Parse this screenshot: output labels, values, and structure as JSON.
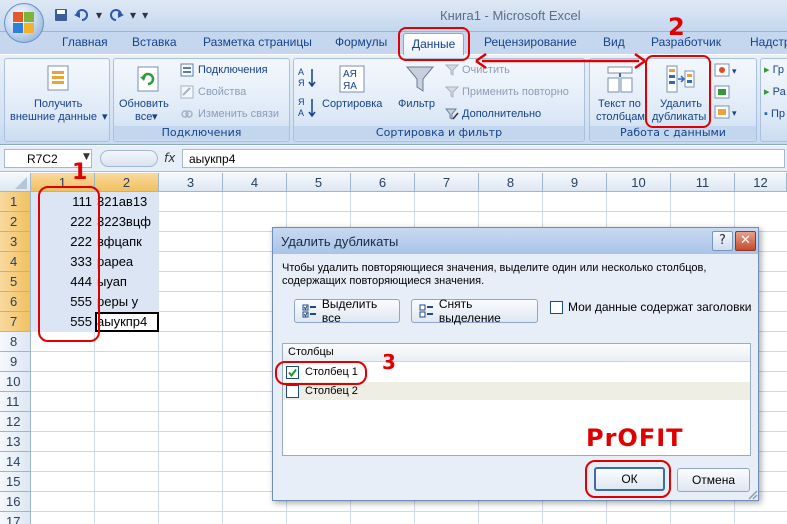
{
  "window": {
    "title": "Книга1 - Microsoft Excel"
  },
  "quick_access": {
    "save_icon": "save-icon",
    "undo_icon": "undo-icon",
    "redo_icon": "redo-icon",
    "customize_glyph": "▾"
  },
  "tabs": [
    {
      "label": "Главная"
    },
    {
      "label": "Вставка"
    },
    {
      "label": "Разметка страницы"
    },
    {
      "label": "Формулы"
    },
    {
      "label": "Данные",
      "active": true
    },
    {
      "label": "Рецензирование"
    },
    {
      "label": "Вид"
    },
    {
      "label": "Разработчик"
    },
    {
      "label": "Надстр"
    }
  ],
  "ribbon": {
    "get_external": {
      "line1": "Получить",
      "line2": "внешние данные"
    },
    "connections_group": {
      "label": "Подключения",
      "refresh": {
        "line1": "Обновить",
        "line2": "все"
      },
      "connections": "Подключения",
      "properties": "Свойства",
      "edit_links": "Изменить связи"
    },
    "sort_filter_group": {
      "label": "Сортировка и фильтр",
      "sort": "Сортировка",
      "filter": "Фильтр",
      "clear": "Очистить",
      "reapply": "Применить повторно",
      "advanced": "Дополнительно"
    },
    "data_tools_group": {
      "label": "Работа с данными",
      "text_to_columns": {
        "line1": "Текст по",
        "line2": "столбцам"
      },
      "remove_duplicates": {
        "line1": "Удалить",
        "line2": "дубликаты"
      }
    },
    "outline_group": {
      "items": [
        "Гр",
        "Ра",
        "Пр"
      ]
    }
  },
  "formula_bar": {
    "name_box": "R7C2",
    "fx": "fx",
    "value": "аыукпр4"
  },
  "columns": [
    "1",
    "2",
    "3",
    "4",
    "5",
    "6",
    "7",
    "8",
    "9",
    "10",
    "11",
    "12"
  ],
  "rows": [
    "1",
    "2",
    "3",
    "4",
    "5",
    "6",
    "7",
    "8",
    "9",
    "10",
    "11",
    "12",
    "13",
    "14",
    "15",
    "16",
    "17"
  ],
  "cells": [
    {
      "a": "111",
      "b": "321ав13"
    },
    {
      "a": "222",
      "b": "3223вцф"
    },
    {
      "a": "222",
      "b": "вфцапк"
    },
    {
      "a": "333",
      "b": "рареа"
    },
    {
      "a": "444",
      "b": "ыуап"
    },
    {
      "a": "555",
      "b": "реры у"
    },
    {
      "a": "555",
      "b": "аыукпр4"
    }
  ],
  "dialog": {
    "title": "Удалить дубликаты",
    "help": "?",
    "close": "✕",
    "instruction": "Чтобы удалить повторяющиеся значения, выделите один или несколько столбцов, содержащих повторяющиеся значения.",
    "select_all": "Выделить все",
    "unselect_all": "Снять выделение",
    "has_headers": "Мои данные содержат заголовки",
    "columns_header": "Столбцы",
    "column_items": [
      {
        "label": "Столбец 1",
        "checked": true
      },
      {
        "label": "Столбец 2",
        "checked": false
      }
    ],
    "ok": "ОК",
    "cancel": "Отмена"
  },
  "annotations": {
    "n1": "1",
    "n2": "2",
    "n3": "3",
    "profit": "PrOFIT",
    "color": "#e00000"
  }
}
